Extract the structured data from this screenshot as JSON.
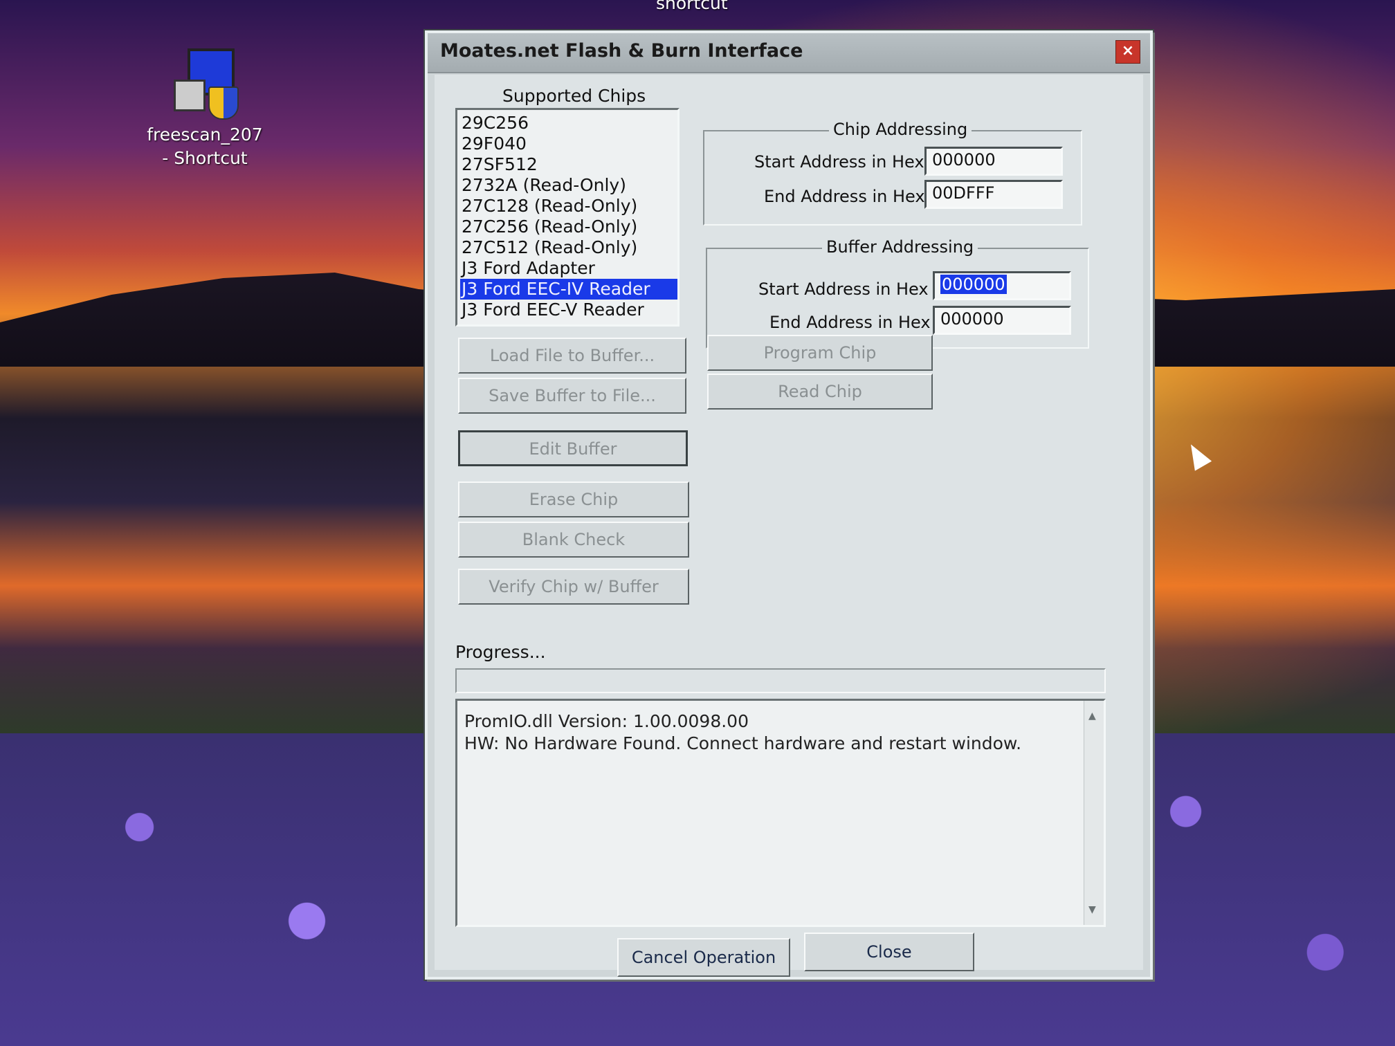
{
  "desktop": {
    "top_label": "shortcut",
    "icon_label_line1": "freescan_207",
    "icon_label_line2": "- Shortcut"
  },
  "window": {
    "title": "Moates.net Flash & Burn Interface",
    "close_glyph": "×"
  },
  "supported_chips": {
    "label": "Supported Chips",
    "items": [
      "29C256",
      "29F040",
      "27SF512",
      "2732A (Read-Only)",
      "27C128 (Read-Only)",
      "27C256 (Read-Only)",
      "27C512 (Read-Only)",
      "J3 Ford Adapter",
      "J3 Ford EEC-IV Reader",
      "J3 Ford EEC-V Reader"
    ],
    "selected": "J3 Ford EEC-IV Reader"
  },
  "chip_addressing": {
    "legend": "Chip Addressing",
    "start_label": "Start Address in Hex",
    "start_value": "000000",
    "end_label": "End Address in Hex",
    "end_value": "00DFFF"
  },
  "buffer_addressing": {
    "legend": "Buffer Addressing",
    "start_label": "Start Address in Hex",
    "start_value": "000000",
    "end_label": "End Address in Hex",
    "end_value": "000000"
  },
  "buttons": {
    "load_file": "Load File to Buffer...",
    "save_buffer": "Save Buffer to File...",
    "program_chip": "Program Chip",
    "read_chip": "Read Chip",
    "edit_buffer": "Edit Buffer",
    "erase_chip": "Erase Chip",
    "blank_check": "Blank Check",
    "verify_chip": "Verify Chip w/ Buffer",
    "cancel": "Cancel Operation",
    "close": "Close"
  },
  "progress": {
    "label": "Progress...",
    "value": 0
  },
  "log": {
    "line1": "PromIO.dll Version: 1.00.0098.00",
    "line2": "HW: No Hardware Found. Connect hardware and restart window."
  },
  "colors": {
    "selection": "#1a3ae8",
    "close_button": "#c8352a"
  }
}
